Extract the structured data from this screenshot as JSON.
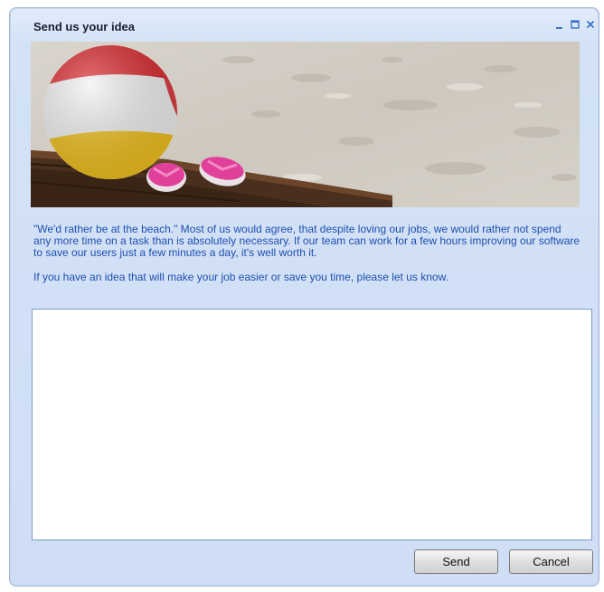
{
  "window": {
    "title": "Send us your idea",
    "controls": {
      "minimize_icon": "minimize-icon",
      "maximize_icon": "maximize-icon",
      "close_icon": "close-icon"
    }
  },
  "banner": {
    "image": "beach-photo",
    "content": [
      "beach ball",
      "pink flip-flops",
      "wooden boardwalk",
      "sand"
    ]
  },
  "intro": {
    "paragraph1": "\"We'd rather be at the beach.\" Most of us would agree, that despite loving our jobs, we would rather not spend any more time on a task than is absolutely necessary. If our team can work for a few hours improving our software to save our users just a few minutes a day, it's well worth it.",
    "paragraph2": "If you have an idea that will make your job easier or save you time, please let us know."
  },
  "idea_input": {
    "value": "",
    "placeholder": ""
  },
  "buttons": {
    "send_label": "Send",
    "cancel_label": "Cancel"
  },
  "colors": {
    "window_bg": "#d3e2f6",
    "text_blue": "#1e4fb0",
    "title_text": "#15202e",
    "control_blue": "#3a72c8"
  }
}
